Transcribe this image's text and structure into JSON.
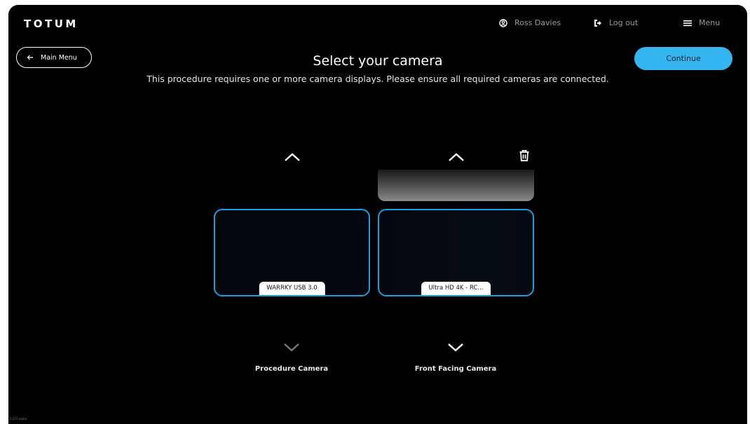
{
  "header": {
    "logo": "TOTUM",
    "user_name": "Ross Davies",
    "logout_label": "Log out",
    "menu_label": "Menu"
  },
  "actions": {
    "main_menu_label": "Main Menu",
    "continue_label": "Continue"
  },
  "page": {
    "title": "Select your camera",
    "subtitle": "This procedure requires one or more camera displays. Please ensure all required cameras are connected."
  },
  "cameras": [
    {
      "device": "WARRKY USB 3.0",
      "role": "Procedure Camera"
    },
    {
      "device": "Ultra HD 4K - RC...",
      "role": "Front Facing Camera"
    }
  ],
  "footer": {
    "version": "0.215-alpha"
  },
  "colors": {
    "accent": "#35b5ef",
    "card_border": "#1b9ede",
    "background": "#000000"
  },
  "icons": [
    "user-circle-icon",
    "logout-icon",
    "menu-icon",
    "arrow-left-icon",
    "chevron-up-icon",
    "chevron-down-icon",
    "trash-icon"
  ]
}
